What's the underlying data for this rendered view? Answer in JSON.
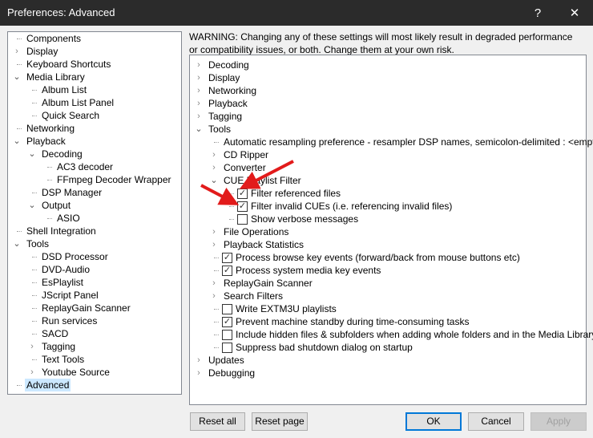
{
  "window": {
    "title": "Preferences: Advanced",
    "help": "?",
    "close": "✕"
  },
  "left_tree": [
    {
      "label": "Components",
      "level": 0,
      "exp": ""
    },
    {
      "label": "Display",
      "level": 0,
      "exp": "closed"
    },
    {
      "label": "Keyboard Shortcuts",
      "level": 0,
      "exp": ""
    },
    {
      "label": "Media Library",
      "level": 0,
      "exp": "open"
    },
    {
      "label": "Album List",
      "level": 1,
      "exp": ""
    },
    {
      "label": "Album List Panel",
      "level": 1,
      "exp": ""
    },
    {
      "label": "Quick Search",
      "level": 1,
      "exp": ""
    },
    {
      "label": "Networking",
      "level": 0,
      "exp": ""
    },
    {
      "label": "Playback",
      "level": 0,
      "exp": "open"
    },
    {
      "label": "Decoding",
      "level": 1,
      "exp": "open"
    },
    {
      "label": "AC3 decoder",
      "level": 2,
      "exp": ""
    },
    {
      "label": "FFmpeg Decoder Wrapper",
      "level": 2,
      "exp": ""
    },
    {
      "label": "DSP Manager",
      "level": 1,
      "exp": ""
    },
    {
      "label": "Output",
      "level": 1,
      "exp": "open"
    },
    {
      "label": "ASIO",
      "level": 2,
      "exp": ""
    },
    {
      "label": "Shell Integration",
      "level": 0,
      "exp": ""
    },
    {
      "label": "Tools",
      "level": 0,
      "exp": "open"
    },
    {
      "label": "DSD Processor",
      "level": 1,
      "exp": ""
    },
    {
      "label": "DVD-Audio",
      "level": 1,
      "exp": ""
    },
    {
      "label": "EsPlaylist",
      "level": 1,
      "exp": ""
    },
    {
      "label": "JScript Panel",
      "level": 1,
      "exp": ""
    },
    {
      "label": "ReplayGain Scanner",
      "level": 1,
      "exp": ""
    },
    {
      "label": "Run services",
      "level": 1,
      "exp": ""
    },
    {
      "label": "SACD",
      "level": 1,
      "exp": ""
    },
    {
      "label": "Tagging",
      "level": 1,
      "exp": "closed"
    },
    {
      "label": "Text Tools",
      "level": 1,
      "exp": ""
    },
    {
      "label": "Youtube Source",
      "level": 1,
      "exp": "closed"
    },
    {
      "label": "Advanced",
      "level": 0,
      "exp": "",
      "selected": true
    }
  ],
  "warning": "WARNING: Changing any of these settings will most likely result in degraded performance or compatibility issues, or both. Change them at your own risk.",
  "right_tree": [
    {
      "label": "Decoding",
      "level": 0,
      "exp": "closed"
    },
    {
      "label": "Display",
      "level": 0,
      "exp": "closed"
    },
    {
      "label": "Networking",
      "level": 0,
      "exp": "closed"
    },
    {
      "label": "Playback",
      "level": 0,
      "exp": "closed"
    },
    {
      "label": "Tagging",
      "level": 0,
      "exp": "closed"
    },
    {
      "label": "Tools",
      "level": 0,
      "exp": "open"
    },
    {
      "label": "Automatic resampling preference - resampler DSP names, semicolon-delimited : <empty>",
      "level": 1,
      "exp": ""
    },
    {
      "label": "CD Ripper",
      "level": 1,
      "exp": "closed"
    },
    {
      "label": "Converter",
      "level": 1,
      "exp": "closed"
    },
    {
      "label": "CUE Playlist Filter",
      "level": 1,
      "exp": "open"
    },
    {
      "label": "Filter referenced files",
      "level": 2,
      "checkbox": true,
      "checked": true
    },
    {
      "label": "Filter invalid CUEs (i.e. referencing invalid files)",
      "level": 2,
      "checkbox": true,
      "checked": true
    },
    {
      "label": "Show verbose messages",
      "level": 2,
      "checkbox": true,
      "checked": false
    },
    {
      "label": "File Operations",
      "level": 1,
      "exp": "closed"
    },
    {
      "label": "Playback Statistics",
      "level": 1,
      "exp": "closed"
    },
    {
      "label": "Process browse key events (forward/back from mouse buttons etc)",
      "level": 1,
      "checkbox": true,
      "checked": true
    },
    {
      "label": "Process system media key events",
      "level": 1,
      "checkbox": true,
      "checked": true
    },
    {
      "label": "ReplayGain Scanner",
      "level": 1,
      "exp": "closed"
    },
    {
      "label": "Search Filters",
      "level": 1,
      "exp": "closed"
    },
    {
      "label": "Write EXTM3U playlists",
      "level": 1,
      "checkbox": true,
      "checked": false
    },
    {
      "label": "Prevent machine standby during time-consuming tasks",
      "level": 1,
      "checkbox": true,
      "checked": true
    },
    {
      "label": "Include hidden files & subfolders when adding whole folders and in the Media Library",
      "level": 1,
      "checkbox": true,
      "checked": false
    },
    {
      "label": "Suppress bad shutdown dialog on startup",
      "level": 1,
      "checkbox": true,
      "checked": false
    },
    {
      "label": "Updates",
      "level": 0,
      "exp": "closed"
    },
    {
      "label": "Debugging",
      "level": 0,
      "exp": "closed"
    }
  ],
  "buttons": {
    "reset_all": "Reset all",
    "reset_page": "Reset page",
    "ok": "OK",
    "cancel": "Cancel",
    "apply": "Apply"
  },
  "colors": {
    "titlebar": "#2b2b2b",
    "selection": "#cce8ff",
    "accent": "#0078d7",
    "arrow": "#e21b1b"
  }
}
